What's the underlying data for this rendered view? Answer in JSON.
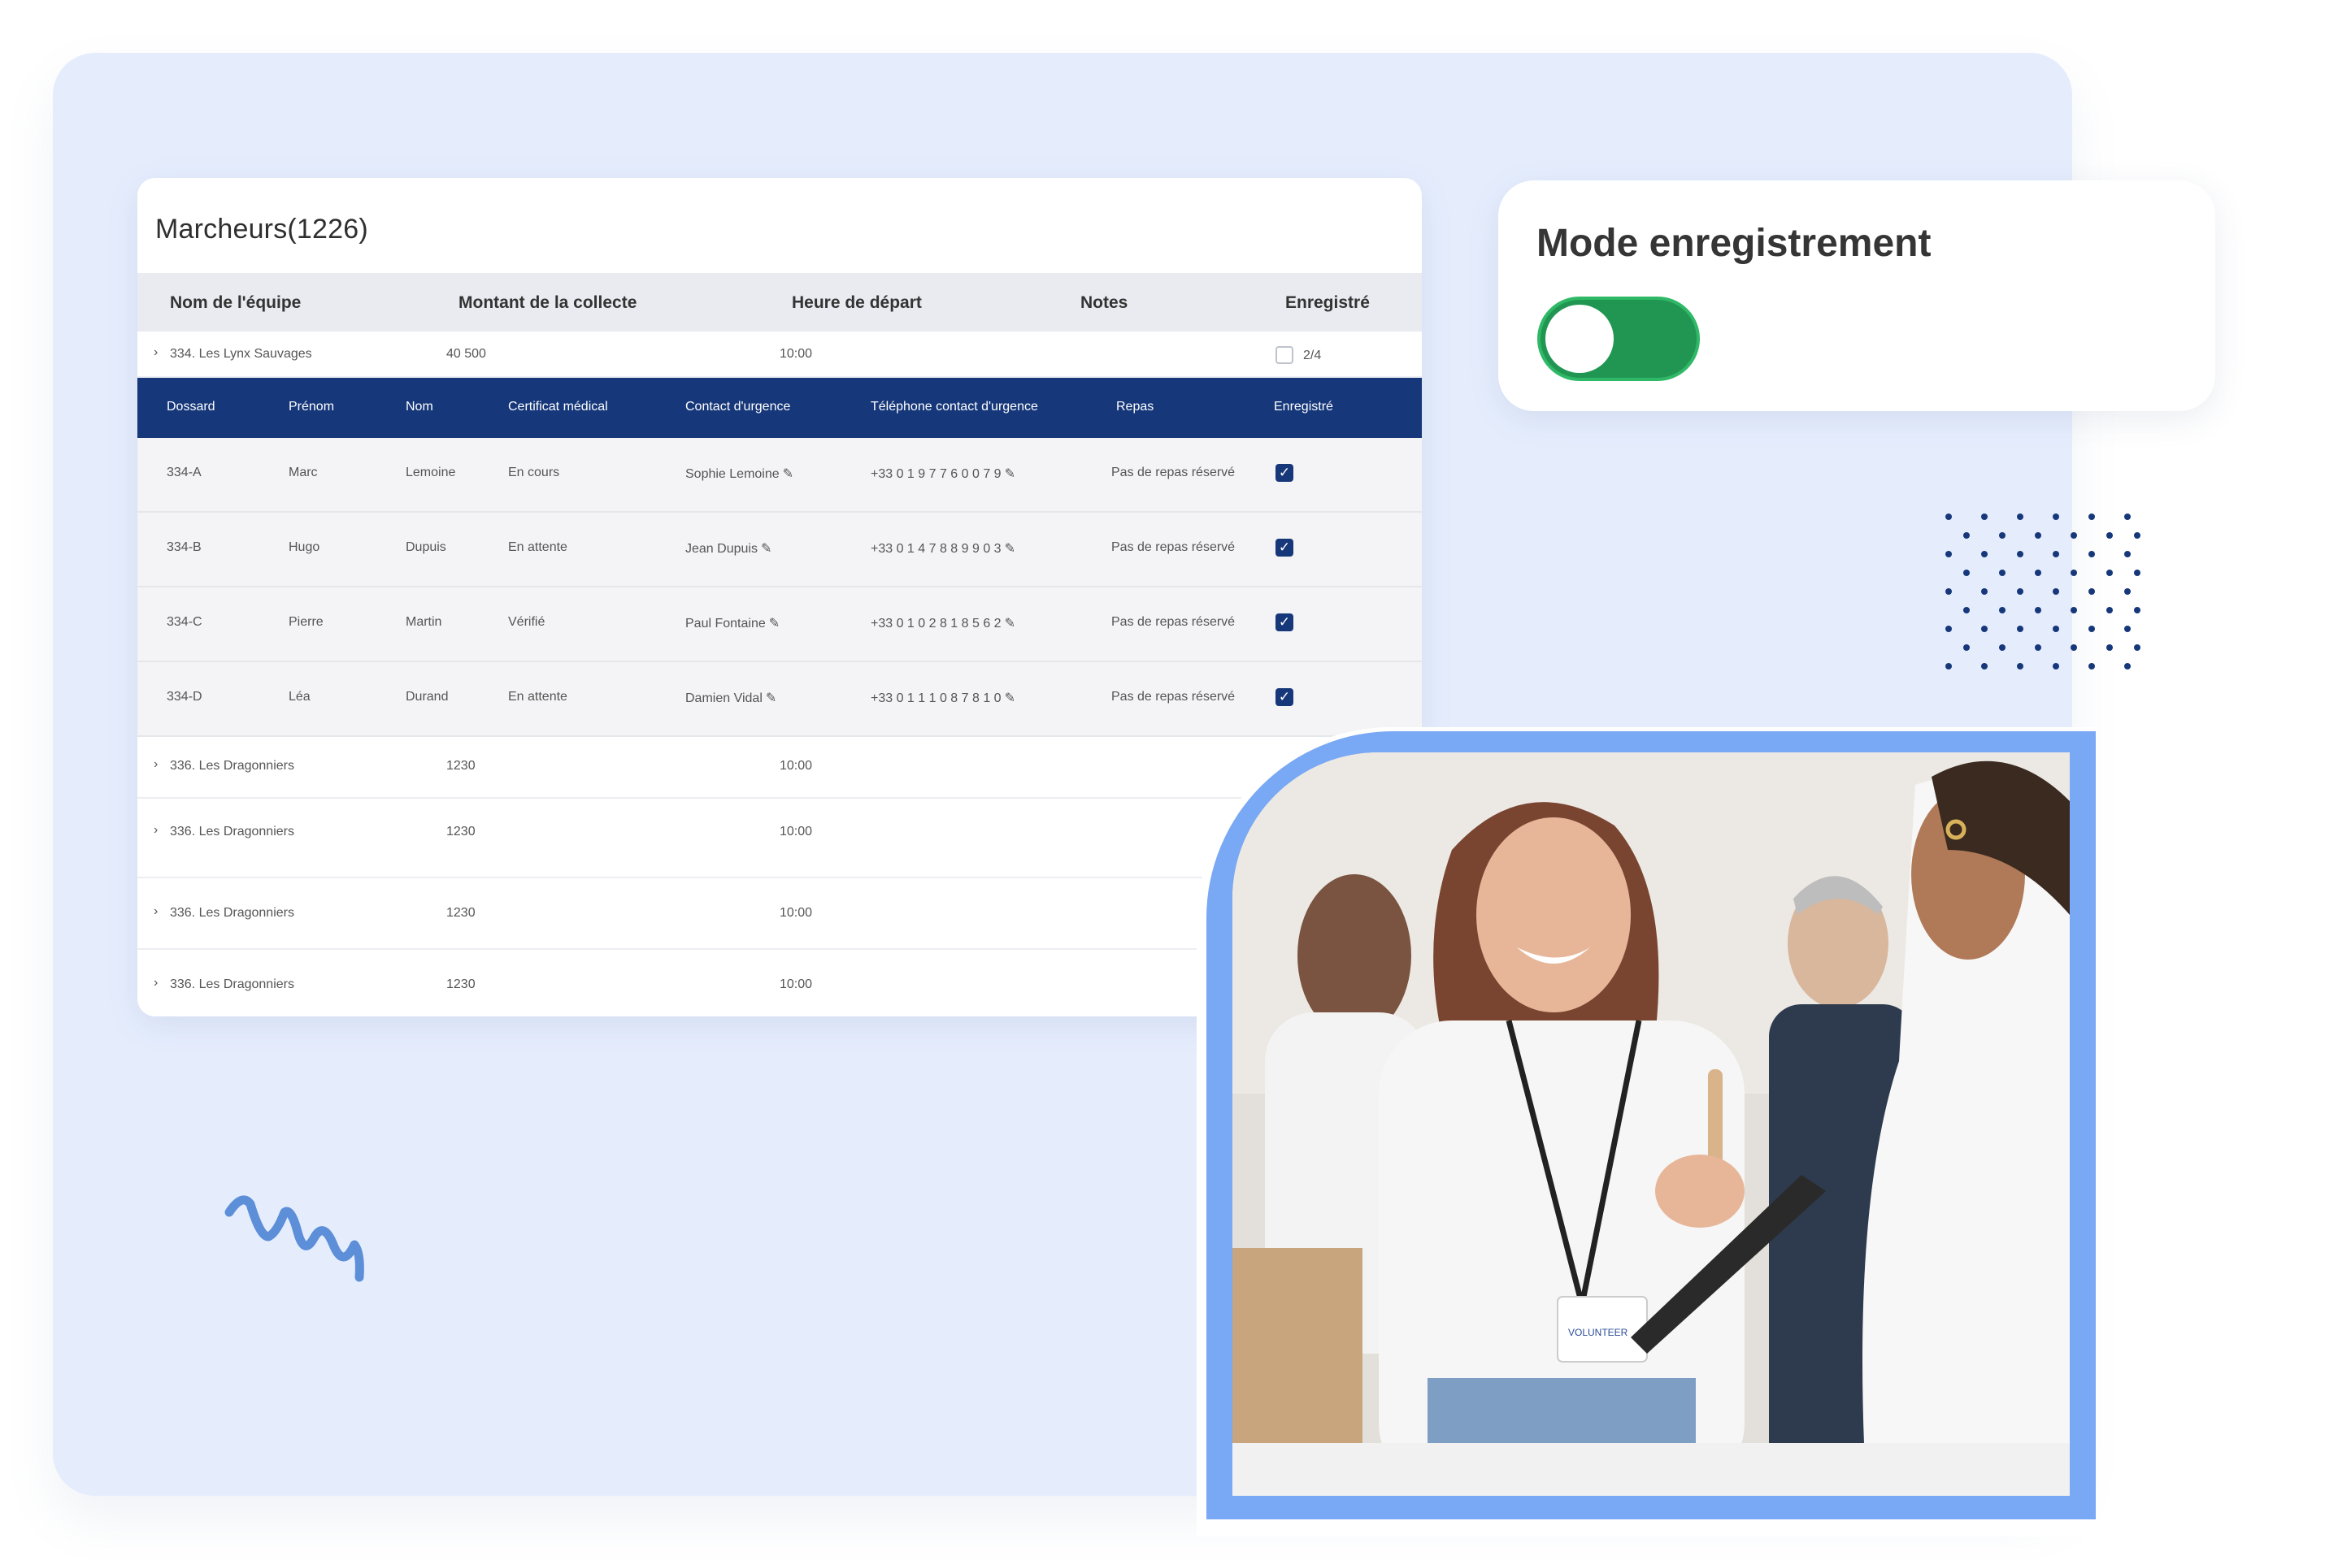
{
  "table": {
    "title": "Marcheurs(1226)",
    "columns": [
      "Nom de l'équipe",
      "Montant de la collecte",
      "Heure de départ",
      "Notes",
      "Enregistré"
    ],
    "first_team": {
      "name": "334. Les Lynx Sauvages",
      "amount": "40 500",
      "time": "10:00",
      "registered": "2/4"
    },
    "sub_columns": [
      "Dossard",
      "Prénom",
      "Nom",
      "Certificat médical",
      "Contact d'urgence",
      "Téléphone contact d'urgence",
      "Repas",
      "Enregistré"
    ],
    "walkers": [
      {
        "bib": "334-A",
        "first": "Marc",
        "last": "Lemoine",
        "cert": "En cours",
        "contact": "Sophie Lemoine",
        "phone": "+33 0 1 9 7 7 6 0 0 7 9",
        "meal": "Pas de repas réservé"
      },
      {
        "bib": "334-B",
        "first": "Hugo",
        "last": "Dupuis",
        "cert": "En attente",
        "contact": "Jean Dupuis",
        "phone": "+33 0 1 4 7 8 8 9 9 0 3",
        "meal": "Pas de repas réservé"
      },
      {
        "bib": "334-C",
        "first": "Pierre",
        "last": "Martin",
        "cert": "Vérifié",
        "contact": "Paul Fontaine",
        "phone": "+33 0 1 0 2 8 1 8 5 6 2",
        "meal": "Pas de repas réservé"
      },
      {
        "bib": "334-D",
        "first": "Léa",
        "last": "Durand",
        "cert": "En attente",
        "contact": "Damien Vidal",
        "phone": "+33 0 1 1 1 0 8 7 8 1 0",
        "meal": "Pas de repas réservé"
      }
    ],
    "other_teams": [
      {
        "name": "336. Les Dragonniers",
        "amount": "1230",
        "time": "10:00"
      },
      {
        "name": "336. Les Dragonniers",
        "amount": "1230",
        "time": "10:00"
      },
      {
        "name": "336. Les Dragonniers",
        "amount": "1230",
        "time": "10:00"
      },
      {
        "name": "336. Les Dragonniers",
        "amount": "1230",
        "time": "10:00"
      }
    ]
  },
  "mode": {
    "title": "Mode enregistrement",
    "toggle_on": true
  },
  "photo": {
    "badge": "VOLUNTEER"
  },
  "colors": {
    "navy": "#16387a",
    "green": "#219653",
    "panel": "#e5edfd",
    "frame": "#79a8f4"
  }
}
